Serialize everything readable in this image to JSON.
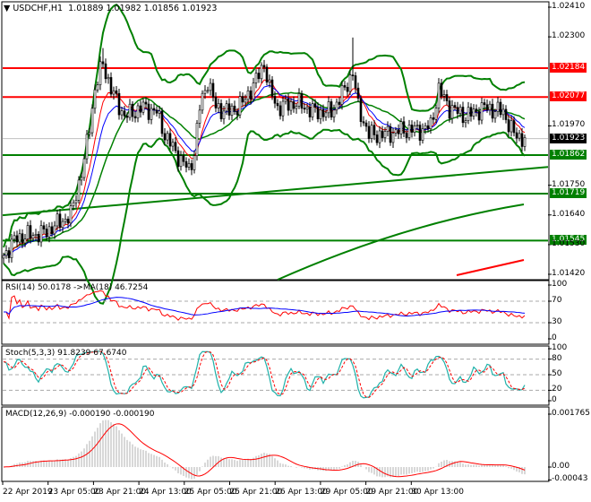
{
  "header": {
    "symbol": "USDCHF,H1",
    "open": "1.01889",
    "high": "1.01982",
    "low": "1.01856",
    "close": "1.01923"
  },
  "price_axis": {
    "ticks": [
      "1.02410",
      "1.02300",
      "1.01970",
      "1.01750",
      "1.01640",
      "1.01530",
      "1.01420"
    ],
    "range": [
      1.0142,
      1.0241
    ]
  },
  "levels": [
    {
      "value": "1.02184",
      "color": "#ff0000"
    },
    {
      "value": "1.02077",
      "color": "#ff0000"
    },
    {
      "value": "1.01862",
      "color": "#008000"
    },
    {
      "value": "1.01719",
      "color": "#008000"
    },
    {
      "value": "1.01545",
      "color": "#008000"
    }
  ],
  "current_price": {
    "value": "1.01923",
    "color": "#000000"
  },
  "chart_data": {
    "type": "candlestick",
    "price_path": [
      [
        0,
        1.0149
      ],
      [
        5,
        1.01556
      ],
      [
        15,
        1.01573
      ],
      [
        25,
        1.01639
      ],
      [
        30,
        1.01839
      ],
      [
        34,
        1.02104
      ],
      [
        37,
        1.02204
      ],
      [
        40,
        1.02104
      ],
      [
        45,
        1.02005
      ],
      [
        52,
        1.02038
      ],
      [
        57,
        1.02021
      ],
      [
        60,
        1.01938
      ],
      [
        64,
        1.01872
      ],
      [
        69,
        1.01805
      ],
      [
        71,
        1.01872
      ],
      [
        73,
        1.02038
      ],
      [
        76,
        1.02138
      ],
      [
        79,
        1.02038
      ],
      [
        84,
        1.02021
      ],
      [
        89,
        1.02055
      ],
      [
        94,
        1.02138
      ],
      [
        97,
        1.02204
      ],
      [
        99,
        1.02104
      ],
      [
        102,
        1.02038
      ],
      [
        109,
        1.02055
      ],
      [
        116,
        1.02021
      ],
      [
        122,
        1.02021
      ],
      [
        127,
        1.02104
      ],
      [
        130,
        1.02171
      ],
      [
        132,
        1.02038
      ],
      [
        136,
        1.01938
      ],
      [
        142,
        1.01938
      ],
      [
        149,
        1.01955
      ],
      [
        156,
        1.01955
      ],
      [
        159,
        1.01971
      ],
      [
        162,
        1.02104
      ],
      [
        166,
        1.02038
      ],
      [
        172,
        1.02005
      ],
      [
        179,
        1.02038
      ],
      [
        186,
        1.02021
      ],
      [
        190,
        1.01938
      ],
      [
        194,
        1.01922
      ]
    ],
    "rsi": {
      "label": "RSI(14) 50.0178  ->MA(18) 46.7254",
      "levels": [
        "100",
        "70",
        "30",
        "0"
      ]
    },
    "stoch": {
      "label": "Stoch(5,3,3) 91.8239 67.6740",
      "levels": [
        "100",
        "80",
        "50",
        "20",
        "0"
      ]
    },
    "macd": {
      "label": "MACD(12,26,9) -0.000190 -0.000190",
      "levels": [
        "0.001765",
        "0.00",
        "-0.00043"
      ]
    },
    "time_labels": [
      "22 Apr 2019",
      "23 Apr 05:00",
      "23 Apr 21:00",
      "24 Apr 13:00",
      "25 Apr 05:00",
      "25 Apr 21:00",
      "26 Apr 13:00",
      "29 Apr 05:00",
      "29 Apr 21:00",
      "30 Apr 13:00"
    ]
  }
}
